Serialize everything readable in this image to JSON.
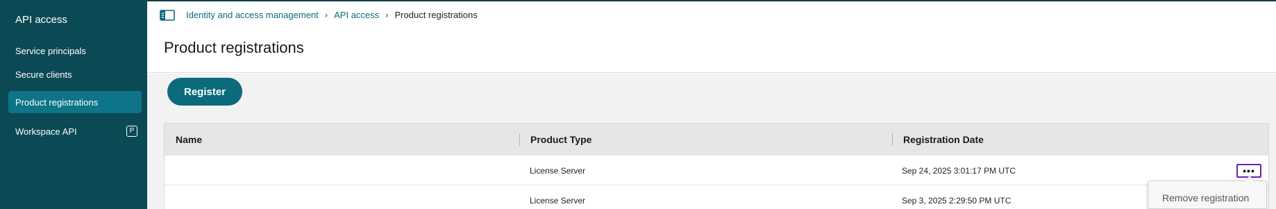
{
  "sidebar": {
    "title": "API access",
    "items": [
      {
        "label": "Service principals"
      },
      {
        "label": "Secure clients"
      },
      {
        "label": "Product registrations"
      },
      {
        "label": "Workspace API",
        "badge": "P"
      }
    ]
  },
  "header": {
    "panel_icon": "panel-toggle-icon",
    "breadcrumb": {
      "items": [
        "Identity and access management",
        "API access"
      ],
      "separator": "›",
      "current": "Product registrations"
    },
    "title": "Product registrations"
  },
  "toolbar": {
    "register_label": "Register"
  },
  "table": {
    "columns": [
      "Name",
      "Product Type",
      "Registration Date"
    ],
    "rows": [
      {
        "name": "",
        "product_type": "License Server",
        "registration_date": "Sep 24, 2025 3:01:17 PM UTC",
        "actions": "•••"
      },
      {
        "name": "",
        "product_type": "License Server",
        "registration_date": "Sep 3, 2025 2:29:50 PM UTC"
      }
    ]
  },
  "context_menu": {
    "items": [
      {
        "label": "Remove registration"
      }
    ]
  },
  "colors": {
    "sidebar_bg": "#0b4a55",
    "sidebar_active": "#0e7487",
    "accent": "#0b6b7c",
    "focus_ring": "#6a1fb8"
  }
}
